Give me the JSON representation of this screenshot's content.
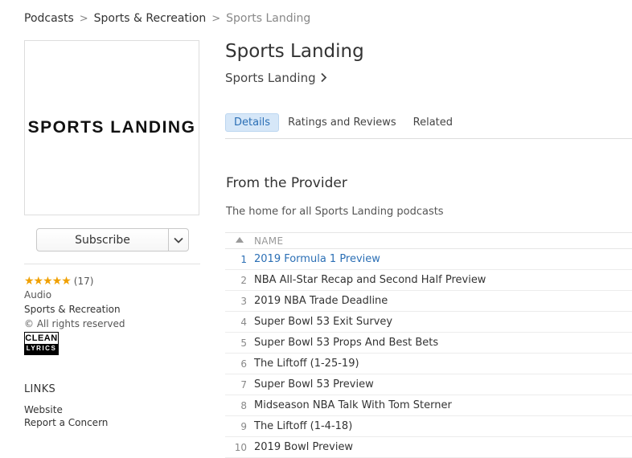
{
  "breadcrumb": {
    "items": [
      "Podcasts",
      "Sports & Recreation",
      "Sports Landing"
    ],
    "separator": ">"
  },
  "artwork": {
    "logo_text": "SPORTS LANDING"
  },
  "subscribe": {
    "label": "Subscribe",
    "dropdown_icon": "chevron-down-icon"
  },
  "rating": {
    "stars": "★★★★★",
    "count": "(17)",
    "value": 5,
    "star_color": "#f0a000"
  },
  "meta": {
    "kind": "Audio",
    "category": "Sports & Recreation",
    "copyright": "© All rights reserved"
  },
  "clean_badge": {
    "top": "CLEAN",
    "bottom": "LYRICS"
  },
  "links": {
    "heading": "LINKS",
    "items": [
      "Website",
      "Report a Concern"
    ]
  },
  "podcast": {
    "title": "Sports Landing",
    "provider": "Sports Landing"
  },
  "tabs": [
    "Details",
    "Ratings and Reviews",
    "Related"
  ],
  "active_tab": "Details",
  "provider_section": {
    "heading": "From the Provider",
    "description": "The home for all Sports Landing podcasts"
  },
  "episodes": {
    "sort_icon": "sort-up-icon",
    "column_header": "NAME",
    "rows": [
      {
        "num": "1",
        "name": "2019 Formula 1 Preview"
      },
      {
        "num": "2",
        "name": "NBA All-Star Recap and Second Half Preview"
      },
      {
        "num": "3",
        "name": "2019 NBA Trade Deadline"
      },
      {
        "num": "4",
        "name": "Super Bowl 53 Exit Survey"
      },
      {
        "num": "5",
        "name": "Super Bowl 53 Props And Best Bets"
      },
      {
        "num": "6",
        "name": "The Liftoff (1-25-19)"
      },
      {
        "num": "7",
        "name": "Super Bowl 53 Preview"
      },
      {
        "num": "8",
        "name": "Midseason NBA Talk With Tom Sterner"
      },
      {
        "num": "9",
        "name": "The Liftoff (1-4-18)"
      },
      {
        "num": "10",
        "name": "2019 Bowl Preview"
      }
    ]
  },
  "colors": {
    "accent": "#2b6fb5",
    "tab_active_bg": "#d6e7f8"
  }
}
